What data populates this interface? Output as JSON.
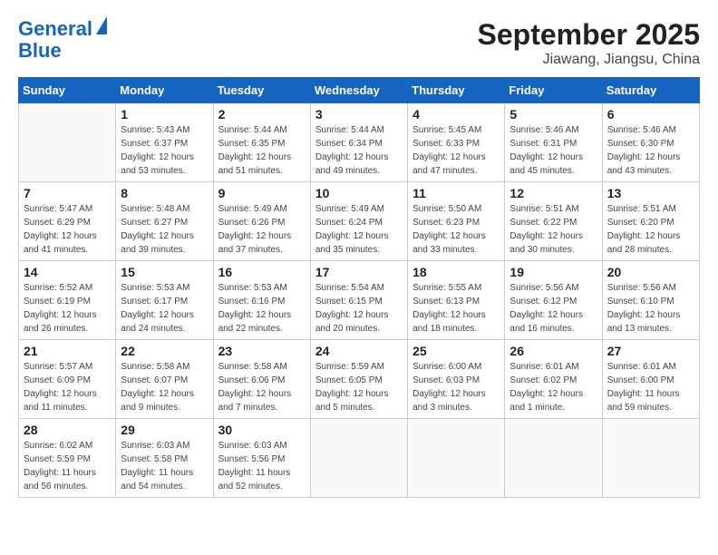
{
  "header": {
    "logo_line1": "General",
    "logo_line2": "Blue",
    "title": "September 2025",
    "subtitle": "Jiawang, Jiangsu, China"
  },
  "weekdays": [
    "Sunday",
    "Monday",
    "Tuesday",
    "Wednesday",
    "Thursday",
    "Friday",
    "Saturday"
  ],
  "weeks": [
    [
      {
        "day": "",
        "info": ""
      },
      {
        "day": "1",
        "info": "Sunrise: 5:43 AM\nSunset: 6:37 PM\nDaylight: 12 hours\nand 53 minutes."
      },
      {
        "day": "2",
        "info": "Sunrise: 5:44 AM\nSunset: 6:35 PM\nDaylight: 12 hours\nand 51 minutes."
      },
      {
        "day": "3",
        "info": "Sunrise: 5:44 AM\nSunset: 6:34 PM\nDaylight: 12 hours\nand 49 minutes."
      },
      {
        "day": "4",
        "info": "Sunrise: 5:45 AM\nSunset: 6:33 PM\nDaylight: 12 hours\nand 47 minutes."
      },
      {
        "day": "5",
        "info": "Sunrise: 5:46 AM\nSunset: 6:31 PM\nDaylight: 12 hours\nand 45 minutes."
      },
      {
        "day": "6",
        "info": "Sunrise: 5:46 AM\nSunset: 6:30 PM\nDaylight: 12 hours\nand 43 minutes."
      }
    ],
    [
      {
        "day": "7",
        "info": "Sunrise: 5:47 AM\nSunset: 6:29 PM\nDaylight: 12 hours\nand 41 minutes."
      },
      {
        "day": "8",
        "info": "Sunrise: 5:48 AM\nSunset: 6:27 PM\nDaylight: 12 hours\nand 39 minutes."
      },
      {
        "day": "9",
        "info": "Sunrise: 5:49 AM\nSunset: 6:26 PM\nDaylight: 12 hours\nand 37 minutes."
      },
      {
        "day": "10",
        "info": "Sunrise: 5:49 AM\nSunset: 6:24 PM\nDaylight: 12 hours\nand 35 minutes."
      },
      {
        "day": "11",
        "info": "Sunrise: 5:50 AM\nSunset: 6:23 PM\nDaylight: 12 hours\nand 33 minutes."
      },
      {
        "day": "12",
        "info": "Sunrise: 5:51 AM\nSunset: 6:22 PM\nDaylight: 12 hours\nand 30 minutes."
      },
      {
        "day": "13",
        "info": "Sunrise: 5:51 AM\nSunset: 6:20 PM\nDaylight: 12 hours\nand 28 minutes."
      }
    ],
    [
      {
        "day": "14",
        "info": "Sunrise: 5:52 AM\nSunset: 6:19 PM\nDaylight: 12 hours\nand 26 minutes."
      },
      {
        "day": "15",
        "info": "Sunrise: 5:53 AM\nSunset: 6:17 PM\nDaylight: 12 hours\nand 24 minutes."
      },
      {
        "day": "16",
        "info": "Sunrise: 5:53 AM\nSunset: 6:16 PM\nDaylight: 12 hours\nand 22 minutes."
      },
      {
        "day": "17",
        "info": "Sunrise: 5:54 AM\nSunset: 6:15 PM\nDaylight: 12 hours\nand 20 minutes."
      },
      {
        "day": "18",
        "info": "Sunrise: 5:55 AM\nSunset: 6:13 PM\nDaylight: 12 hours\nand 18 minutes."
      },
      {
        "day": "19",
        "info": "Sunrise: 5:56 AM\nSunset: 6:12 PM\nDaylight: 12 hours\nand 16 minutes."
      },
      {
        "day": "20",
        "info": "Sunrise: 5:56 AM\nSunset: 6:10 PM\nDaylight: 12 hours\nand 13 minutes."
      }
    ],
    [
      {
        "day": "21",
        "info": "Sunrise: 5:57 AM\nSunset: 6:09 PM\nDaylight: 12 hours\nand 11 minutes."
      },
      {
        "day": "22",
        "info": "Sunrise: 5:58 AM\nSunset: 6:07 PM\nDaylight: 12 hours\nand 9 minutes."
      },
      {
        "day": "23",
        "info": "Sunrise: 5:58 AM\nSunset: 6:06 PM\nDaylight: 12 hours\nand 7 minutes."
      },
      {
        "day": "24",
        "info": "Sunrise: 5:59 AM\nSunset: 6:05 PM\nDaylight: 12 hours\nand 5 minutes."
      },
      {
        "day": "25",
        "info": "Sunrise: 6:00 AM\nSunset: 6:03 PM\nDaylight: 12 hours\nand 3 minutes."
      },
      {
        "day": "26",
        "info": "Sunrise: 6:01 AM\nSunset: 6:02 PM\nDaylight: 12 hours\nand 1 minute."
      },
      {
        "day": "27",
        "info": "Sunrise: 6:01 AM\nSunset: 6:00 PM\nDaylight: 11 hours\nand 59 minutes."
      }
    ],
    [
      {
        "day": "28",
        "info": "Sunrise: 6:02 AM\nSunset: 5:59 PM\nDaylight: 11 hours\nand 56 minutes."
      },
      {
        "day": "29",
        "info": "Sunrise: 6:03 AM\nSunset: 5:58 PM\nDaylight: 11 hours\nand 54 minutes."
      },
      {
        "day": "30",
        "info": "Sunrise: 6:03 AM\nSunset: 5:56 PM\nDaylight: 11 hours\nand 52 minutes."
      },
      {
        "day": "",
        "info": ""
      },
      {
        "day": "",
        "info": ""
      },
      {
        "day": "",
        "info": ""
      },
      {
        "day": "",
        "info": ""
      }
    ]
  ]
}
